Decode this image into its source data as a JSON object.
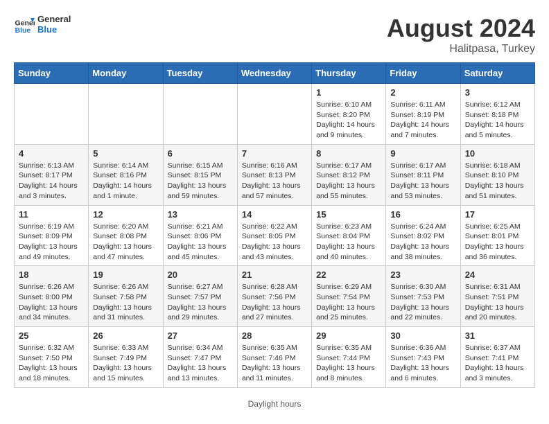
{
  "header": {
    "logo_general": "General",
    "logo_blue": "Blue",
    "main_title": "August 2024",
    "subtitle": "Halitpasa, Turkey"
  },
  "calendar": {
    "days_of_week": [
      "Sunday",
      "Monday",
      "Tuesday",
      "Wednesday",
      "Thursday",
      "Friday",
      "Saturday"
    ],
    "weeks": [
      [
        {
          "day": "",
          "detail": ""
        },
        {
          "day": "",
          "detail": ""
        },
        {
          "day": "",
          "detail": ""
        },
        {
          "day": "",
          "detail": ""
        },
        {
          "day": "1",
          "detail": "Sunrise: 6:10 AM\nSunset: 8:20 PM\nDaylight: 14 hours\nand 9 minutes."
        },
        {
          "day": "2",
          "detail": "Sunrise: 6:11 AM\nSunset: 8:19 PM\nDaylight: 14 hours\nand 7 minutes."
        },
        {
          "day": "3",
          "detail": "Sunrise: 6:12 AM\nSunset: 8:18 PM\nDaylight: 14 hours\nand 5 minutes."
        }
      ],
      [
        {
          "day": "4",
          "detail": "Sunrise: 6:13 AM\nSunset: 8:17 PM\nDaylight: 14 hours\nand 3 minutes."
        },
        {
          "day": "5",
          "detail": "Sunrise: 6:14 AM\nSunset: 8:16 PM\nDaylight: 14 hours\nand 1 minute."
        },
        {
          "day": "6",
          "detail": "Sunrise: 6:15 AM\nSunset: 8:15 PM\nDaylight: 13 hours\nand 59 minutes."
        },
        {
          "day": "7",
          "detail": "Sunrise: 6:16 AM\nSunset: 8:13 PM\nDaylight: 13 hours\nand 57 minutes."
        },
        {
          "day": "8",
          "detail": "Sunrise: 6:17 AM\nSunset: 8:12 PM\nDaylight: 13 hours\nand 55 minutes."
        },
        {
          "day": "9",
          "detail": "Sunrise: 6:17 AM\nSunset: 8:11 PM\nDaylight: 13 hours\nand 53 minutes."
        },
        {
          "day": "10",
          "detail": "Sunrise: 6:18 AM\nSunset: 8:10 PM\nDaylight: 13 hours\nand 51 minutes."
        }
      ],
      [
        {
          "day": "11",
          "detail": "Sunrise: 6:19 AM\nSunset: 8:09 PM\nDaylight: 13 hours\nand 49 minutes."
        },
        {
          "day": "12",
          "detail": "Sunrise: 6:20 AM\nSunset: 8:08 PM\nDaylight: 13 hours\nand 47 minutes."
        },
        {
          "day": "13",
          "detail": "Sunrise: 6:21 AM\nSunset: 8:06 PM\nDaylight: 13 hours\nand 45 minutes."
        },
        {
          "day": "14",
          "detail": "Sunrise: 6:22 AM\nSunset: 8:05 PM\nDaylight: 13 hours\nand 43 minutes."
        },
        {
          "day": "15",
          "detail": "Sunrise: 6:23 AM\nSunset: 8:04 PM\nDaylight: 13 hours\nand 40 minutes."
        },
        {
          "day": "16",
          "detail": "Sunrise: 6:24 AM\nSunset: 8:02 PM\nDaylight: 13 hours\nand 38 minutes."
        },
        {
          "day": "17",
          "detail": "Sunrise: 6:25 AM\nSunset: 8:01 PM\nDaylight: 13 hours\nand 36 minutes."
        }
      ],
      [
        {
          "day": "18",
          "detail": "Sunrise: 6:26 AM\nSunset: 8:00 PM\nDaylight: 13 hours\nand 34 minutes."
        },
        {
          "day": "19",
          "detail": "Sunrise: 6:26 AM\nSunset: 7:58 PM\nDaylight: 13 hours\nand 31 minutes."
        },
        {
          "day": "20",
          "detail": "Sunrise: 6:27 AM\nSunset: 7:57 PM\nDaylight: 13 hours\nand 29 minutes."
        },
        {
          "day": "21",
          "detail": "Sunrise: 6:28 AM\nSunset: 7:56 PM\nDaylight: 13 hours\nand 27 minutes."
        },
        {
          "day": "22",
          "detail": "Sunrise: 6:29 AM\nSunset: 7:54 PM\nDaylight: 13 hours\nand 25 minutes."
        },
        {
          "day": "23",
          "detail": "Sunrise: 6:30 AM\nSunset: 7:53 PM\nDaylight: 13 hours\nand 22 minutes."
        },
        {
          "day": "24",
          "detail": "Sunrise: 6:31 AM\nSunset: 7:51 PM\nDaylight: 13 hours\nand 20 minutes."
        }
      ],
      [
        {
          "day": "25",
          "detail": "Sunrise: 6:32 AM\nSunset: 7:50 PM\nDaylight: 13 hours\nand 18 minutes."
        },
        {
          "day": "26",
          "detail": "Sunrise: 6:33 AM\nSunset: 7:49 PM\nDaylight: 13 hours\nand 15 minutes."
        },
        {
          "day": "27",
          "detail": "Sunrise: 6:34 AM\nSunset: 7:47 PM\nDaylight: 13 hours\nand 13 minutes."
        },
        {
          "day": "28",
          "detail": "Sunrise: 6:35 AM\nSunset: 7:46 PM\nDaylight: 13 hours\nand 11 minutes."
        },
        {
          "day": "29",
          "detail": "Sunrise: 6:35 AM\nSunset: 7:44 PM\nDaylight: 13 hours\nand 8 minutes."
        },
        {
          "day": "30",
          "detail": "Sunrise: 6:36 AM\nSunset: 7:43 PM\nDaylight: 13 hours\nand 6 minutes."
        },
        {
          "day": "31",
          "detail": "Sunrise: 6:37 AM\nSunset: 7:41 PM\nDaylight: 13 hours\nand 3 minutes."
        }
      ]
    ]
  },
  "footer": {
    "note": "Daylight hours"
  }
}
